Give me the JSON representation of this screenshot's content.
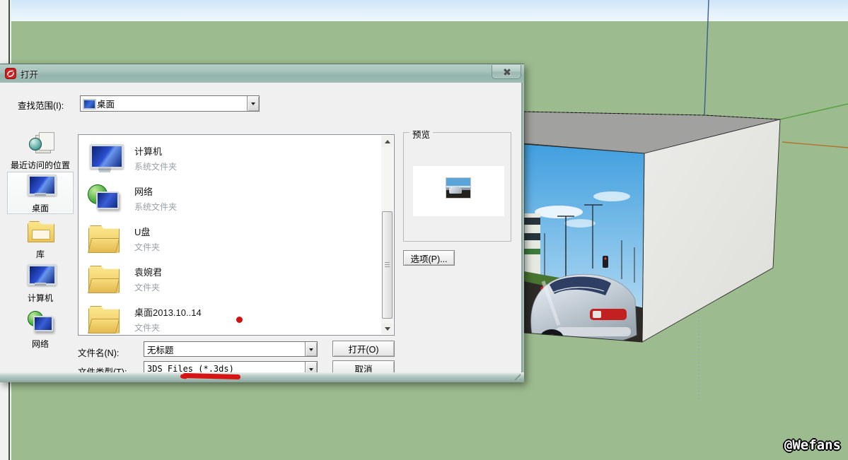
{
  "scene": {
    "watermark": "@Wefans",
    "colors": {
      "ground_green": "#9cbb8e",
      "sky_blue": "#cfe5f7",
      "titlebar_glass": "#a5c2ba",
      "dialog_face": "#f0f0f0",
      "annotation_red": "#d61414",
      "axis_red": "#b5722f",
      "axis_green": "#4f9e38",
      "axis_blue": "#3c5c94",
      "box_top_gray": "#a1a19f",
      "box_side_gray": "#e5e5e2"
    }
  },
  "dialog": {
    "title": "打开",
    "icons": {
      "title": "sketchup-logo-icon",
      "close": "close-icon",
      "look_in_value": "desktop-mini-icon",
      "toolbar": [
        "back-icon",
        "up-folder-icon",
        "new-folder-icon",
        "view-menu-icon",
        "chevron-down-icon"
      ]
    },
    "look_in": {
      "label": "查找范围(I):",
      "value": "桌面"
    },
    "sidebar": {
      "items": [
        {
          "label": "最近访问的位置",
          "icon": "recent",
          "selected": false
        },
        {
          "label": "桌面",
          "icon": "desktop",
          "selected": true
        },
        {
          "label": "库",
          "icon": "libraries",
          "selected": false
        },
        {
          "label": "计算机",
          "icon": "computer",
          "selected": false
        },
        {
          "label": "网络",
          "icon": "network",
          "selected": false
        }
      ]
    },
    "files": {
      "items": [
        {
          "name": "计算机",
          "type": "系统文件夹",
          "icon": "computer"
        },
        {
          "name": "网络",
          "type": "系统文件夹",
          "icon": "network"
        },
        {
          "name": "U盘",
          "type": "文件夹",
          "icon": "folder-image"
        },
        {
          "name": "袁婉君",
          "type": "文件夹",
          "icon": "folder-cards"
        },
        {
          "name": "桌面2013.10..14",
          "type": "文件夹",
          "icon": "folder-docs"
        }
      ]
    },
    "fields": {
      "file_name_label": "文件名(N):",
      "file_name_value": "无标题",
      "file_type_label": "文件类型(T):",
      "file_type_value": "3DS Files (*.3ds)"
    },
    "buttons": {
      "open": "打开(O)",
      "cancel": "取消",
      "options": "选项(P)..."
    },
    "preview": {
      "label": "预览"
    }
  }
}
